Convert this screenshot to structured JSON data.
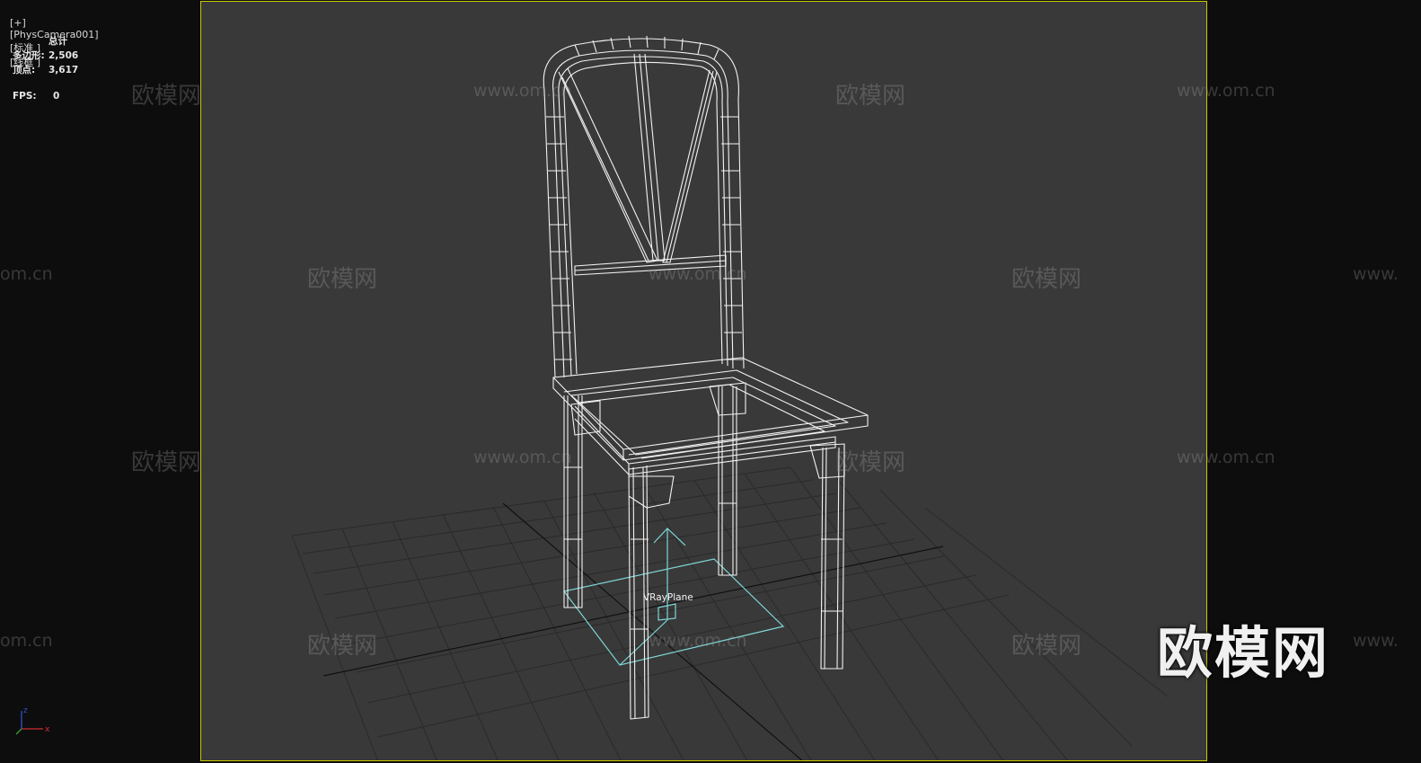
{
  "viewport": {
    "labels": [
      "[+]",
      "[PhysCamera001]",
      "[标准 ]",
      "[线框 ]"
    ]
  },
  "stats": {
    "header": "总计",
    "polygons_label": "多边形:",
    "polygons_value": "2,506",
    "vertices_label": "顶点:",
    "vertices_value": "3,617",
    "fps_label": "FPS:",
    "fps_value": "0"
  },
  "scene": {
    "object_label": "VRayPlane"
  },
  "watermark": {
    "brand": "欧模网",
    "url": "www.om.cn",
    "url_cut_left": "om.cn",
    "url_cut_right": "www."
  },
  "axis_gizmo": {
    "x": "x",
    "z": "z"
  },
  "colors": {
    "frame_border": "#c8c800",
    "viewport_bg": "#393939",
    "wire": "#f2f2f2",
    "helper": "#7fd6d6",
    "axis_x": "#d03030",
    "axis_z": "#3050d0"
  }
}
